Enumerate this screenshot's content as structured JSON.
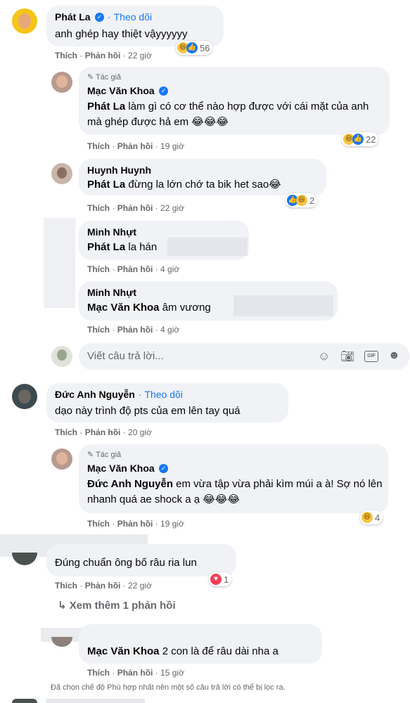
{
  "colors": {
    "accent": "#1877f2",
    "bubble": "#f0f2f5",
    "muted": "#65676b",
    "haha": "#f7c541",
    "love": "#f33e58"
  },
  "actions": {
    "like": "Thích",
    "reply": "Phản hồi",
    "sep": "·"
  },
  "author_tag": "Tác giả",
  "c1": {
    "name": "Phát La",
    "follow": "Theo dõi",
    "text": "anh ghép hay thiệt vậyyyyyy",
    "time": "22 giờ",
    "react_count": "56"
  },
  "r1": {
    "name": "Mạc Văn Khoa",
    "mention": "Phát La",
    "text": " làm gì có cơ thể nào hợp được với cái mặt của anh mà ghép được hả em 😂😂😂",
    "time": "19 giờ",
    "react_count": "22"
  },
  "r2": {
    "name": "Huynh Huynh",
    "mention": "Phát La",
    "text": " đừng la lớn chớ ta bik het sao😂",
    "time": "22 giờ",
    "react_count": "2"
  },
  "r3": {
    "name": "Minh Nhựt",
    "mention": "Phát La",
    "text": " la hán",
    "time": "4 giờ"
  },
  "r4": {
    "name": "Minh Nhựt",
    "mention": "Mạc Văn Khoa",
    "text": " âm vương",
    "time": "4 giờ"
  },
  "reply_box": {
    "placeholder": "Viết câu trả lời..."
  },
  "c2": {
    "name": "Đức Anh Nguyễn",
    "follow": "Theo dõi",
    "text": "dạo này trình độ pts của em lên tay quá",
    "time": "20 giờ"
  },
  "r5": {
    "name": "Mạc Văn Khoa",
    "mention": "Đức Anh Nguyễn",
    "text": " em vừa tập vừa phải kìm múi a à! Sợ nó lên nhanh quá ae shock a ạ 😂😂😂",
    "time": "19 giờ",
    "react_count": "4"
  },
  "c3": {
    "text": "Đúng chuẩn ông bố râu ria lun",
    "time": "22 giờ",
    "react_count": "1"
  },
  "more_replies": "Xem thêm 1 phản hồi",
  "r6": {
    "mention": "Mạc Văn Khoa",
    "text": " 2 con là để râu dài nha a",
    "time": "15 giờ"
  },
  "filter_note": "Đã chọn chế độ Phù hợp nhất nên một số câu trả lời có thể bị lọc ra."
}
